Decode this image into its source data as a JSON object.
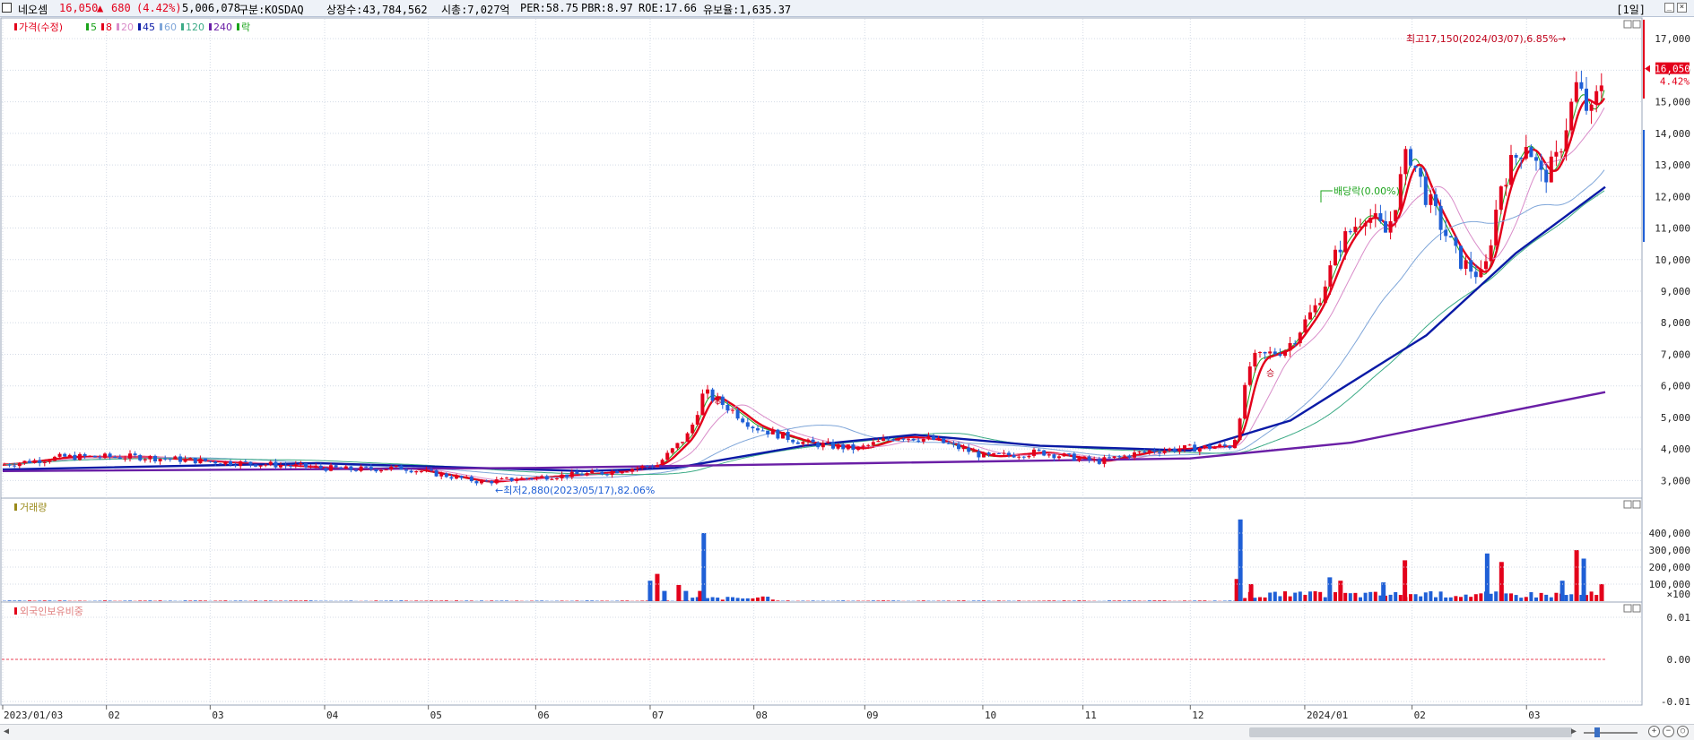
{
  "header": {
    "stock_name": "네오셈",
    "price": "16,050",
    "change_arrow": "▲",
    "change": "680",
    "change_pct": "(4.42%)",
    "volume": "5,006,078",
    "market": "구분:KOSDAQ",
    "shares": "상장수:43,784,562",
    "market_cap": "시총:7,027억",
    "per": "PER:58.75",
    "pbr": "PBR:8.97",
    "roe": "ROE:17.66",
    "float_ratio": "유보율:1,635.37",
    "period": "[1일]",
    "colors": {
      "up": "#e3001b",
      "down": "#1f5fd6"
    }
  },
  "chart_data": {
    "type": "candlestick",
    "legend": [
      {
        "label": "가격(수정)",
        "color": "#e3001b"
      },
      {
        "label": "5",
        "color": "#1aa31a"
      },
      {
        "label": "8",
        "color": "#e3001b"
      },
      {
        "label": "20",
        "color": "#d98cc9"
      },
      {
        "label": "45",
        "color": "#0a1aa6"
      },
      {
        "label": "60",
        "color": "#7fa6d9"
      },
      {
        "label": "120",
        "color": "#3cab86"
      },
      {
        "label": "240",
        "color": "#6a1fa6"
      },
      {
        "label": "락",
        "color": "#1aa31a"
      }
    ],
    "price_axis": {
      "min": 2500,
      "max": 17600,
      "ticks": [
        3000,
        4000,
        5000,
        6000,
        7000,
        8000,
        9000,
        10000,
        11000,
        12000,
        13000,
        14000,
        15000,
        16000,
        17000
      ],
      "tick_labels": [
        "3,000",
        "4,000",
        "5,000",
        "6,000",
        "7,000",
        "8,000",
        "9,000",
        "10,000",
        "11,000",
        "12,000",
        "13,000",
        "14,000",
        "15,000",
        "16,000",
        "17,000"
      ]
    },
    "current_price": {
      "label": "16,050",
      "pct": "4.42%",
      "value": 16050
    },
    "annotations": {
      "high": {
        "text": "최고17,150(2024/03/07),6.85%→",
        "value": 17150
      },
      "low": {
        "text": "←최저2,880(2023/05/17),82.06%",
        "value": 2880
      },
      "dividend": {
        "text": "배당락(0.00%)"
      },
      "rights": {
        "text": "승"
      }
    },
    "x_labels": [
      "2023/01/03",
      "02",
      "03",
      "04",
      "05",
      "06",
      "07",
      "08",
      "09",
      "10",
      "11",
      "12",
      "2024/01",
      "02",
      "03"
    ],
    "price_series": [
      {
        "date": "2023/01/03",
        "value": 3500
      },
      {
        "date": "2023/01/20",
        "value": 3750
      },
      {
        "date": "2023/02/10",
        "value": 3750
      },
      {
        "date": "2023/03/03",
        "value": 3600
      },
      {
        "date": "2023/03/20",
        "value": 3500
      },
      {
        "date": "2023/04/10",
        "value": 3350
      },
      {
        "date": "2023/04/25",
        "value": 3400
      },
      {
        "date": "2023/05/17",
        "value": 2950
      },
      {
        "date": "2023/06/01",
        "value": 3100
      },
      {
        "date": "2023/06/20",
        "value": 3250
      },
      {
        "date": "2023/07/05",
        "value": 3500
      },
      {
        "date": "2023/07/14",
        "value": 4500
      },
      {
        "date": "2023/07/18",
        "value": 5800
      },
      {
        "date": "2023/07/25",
        "value": 5300
      },
      {
        "date": "2023/08/01",
        "value": 4700
      },
      {
        "date": "2023/08/15",
        "value": 4200
      },
      {
        "date": "2023/08/30",
        "value": 4000
      },
      {
        "date": "2023/09/10",
        "value": 4400
      },
      {
        "date": "2023/09/20",
        "value": 4300
      },
      {
        "date": "2023/10/05",
        "value": 3750
      },
      {
        "date": "2023/10/20",
        "value": 3900
      },
      {
        "date": "2023/11/05",
        "value": 3600
      },
      {
        "date": "2023/11/20",
        "value": 3950
      },
      {
        "date": "2023/12/05",
        "value": 4050
      },
      {
        "date": "2023/12/13",
        "value": 4100
      },
      {
        "date": "2023/12/18",
        "value": 6800
      },
      {
        "date": "2023/12/28",
        "value": 7200
      },
      {
        "date": "2024/01/05",
        "value": 8500
      },
      {
        "date": "2024/01/12",
        "value": 10500
      },
      {
        "date": "2024/01/19",
        "value": 11500
      },
      {
        "date": "2024/01/25",
        "value": 10800
      },
      {
        "date": "2024/01/31",
        "value": 13500
      },
      {
        "date": "2024/02/05",
        "value": 12000
      },
      {
        "date": "2024/02/14",
        "value": 10000
      },
      {
        "date": "2024/02/21",
        "value": 9400
      },
      {
        "date": "2024/02/26",
        "value": 12500
      },
      {
        "date": "2024/03/04",
        "value": 13800
      },
      {
        "date": "2024/03/08",
        "value": 12600
      },
      {
        "date": "2024/03/12",
        "value": 13000
      },
      {
        "date": "2024/03/18",
        "value": 15500
      },
      {
        "date": "2024/03/22",
        "value": 14500
      },
      {
        "date": "2024/03/26",
        "value": 16050
      }
    ],
    "ma45": [
      {
        "date": "2023/01/03",
        "value": 3350
      },
      {
        "date": "2023/04/01",
        "value": 3550
      },
      {
        "date": "2023/06/15",
        "value": 3300
      },
      {
        "date": "2023/07/10",
        "value": 3400
      },
      {
        "date": "2023/08/15",
        "value": 4100
      },
      {
        "date": "2023/09/15",
        "value": 4450
      },
      {
        "date": "2023/10/20",
        "value": 4100
      },
      {
        "date": "2023/12/01",
        "value": 3950
      },
      {
        "date": "2023/12/29",
        "value": 4900
      },
      {
        "date": "2024/02/05",
        "value": 7600
      },
      {
        "date": "2024/03/01",
        "value": 10200
      },
      {
        "date": "2024/03/26",
        "value": 12300
      }
    ],
    "ma240": [
      {
        "date": "2023/01/03",
        "value": 3300
      },
      {
        "date": "2023/06/01",
        "value": 3400
      },
      {
        "date": "2023/09/01",
        "value": 3550
      },
      {
        "date": "2023/12/01",
        "value": 3700
      },
      {
        "date": "2024/01/15",
        "value": 4200
      },
      {
        "date": "2024/03/26",
        "value": 5800
      }
    ],
    "volume_panel": {
      "title": "거래량",
      "ticks": [
        100000,
        200000,
        300000,
        400000
      ],
      "tick_labels": [
        "100,000",
        "200,000",
        "300,000",
        "400,000"
      ],
      "unit_label": "×100",
      "max": 500000,
      "spikes": [
        {
          "date": "2023/07/03",
          "value": 120000
        },
        {
          "date": "2023/07/05",
          "value": 160000
        },
        {
          "date": "2023/07/07",
          "value": 60000
        },
        {
          "date": "2023/07/11",
          "value": 95000
        },
        {
          "date": "2023/07/13",
          "value": 60000
        },
        {
          "date": "2023/07/17",
          "value": 60000
        },
        {
          "date": "2023/07/18",
          "value": 400000
        },
        {
          "date": "2023/12/14",
          "value": 130000
        },
        {
          "date": "2023/12/15",
          "value": 480000
        },
        {
          "date": "2023/12/18",
          "value": 100000
        },
        {
          "date": "2024/01/09",
          "value": 140000
        },
        {
          "date": "2024/01/12",
          "value": 120000
        },
        {
          "date": "2024/01/24",
          "value": 110000
        },
        {
          "date": "2024/01/30",
          "value": 240000
        },
        {
          "date": "2024/02/22",
          "value": 280000
        },
        {
          "date": "2024/02/26",
          "value": 230000
        },
        {
          "date": "2024/03/14",
          "value": 120000
        },
        {
          "date": "2024/03/18",
          "value": 300000
        },
        {
          "date": "2024/03/20",
          "value": 250000
        },
        {
          "date": "2024/03/25",
          "value": 100000
        }
      ]
    },
    "foreign_panel": {
      "title": "외국인보유비중",
      "ticks": [
        0.01,
        0.0,
        -0.01
      ],
      "tick_labels": [
        "0.01",
        "0.00",
        "-0.01"
      ]
    }
  }
}
